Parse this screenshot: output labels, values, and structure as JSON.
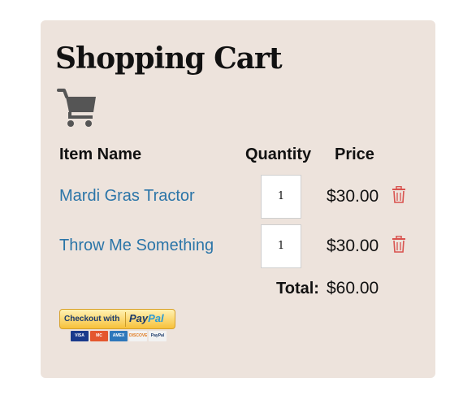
{
  "cart": {
    "title": "Shopping Cart",
    "columns": {
      "item_name": "Item Name",
      "quantity": "Quantity",
      "price": "Price"
    },
    "items": [
      {
        "name": "Mardi Gras Tractor",
        "quantity": "1",
        "price": "$30.00"
      },
      {
        "name": "Throw Me Something",
        "quantity": "1",
        "price": "$30.00"
      }
    ],
    "total_label": "Total:",
    "total_value": "$60.00",
    "checkout": {
      "label": "Checkout with",
      "brand_pay": "Pay",
      "brand_pal": "Pal",
      "cards": [
        "VISA",
        "MC",
        "AMEX",
        "DISCOVER",
        "PayPal"
      ]
    }
  },
  "colors": {
    "panel_bg": "#ede3dc",
    "link": "#2b75a8",
    "trash": "#d9534f"
  },
  "icons": {
    "cart": "shopping-cart-icon",
    "remove": "trash-icon"
  }
}
